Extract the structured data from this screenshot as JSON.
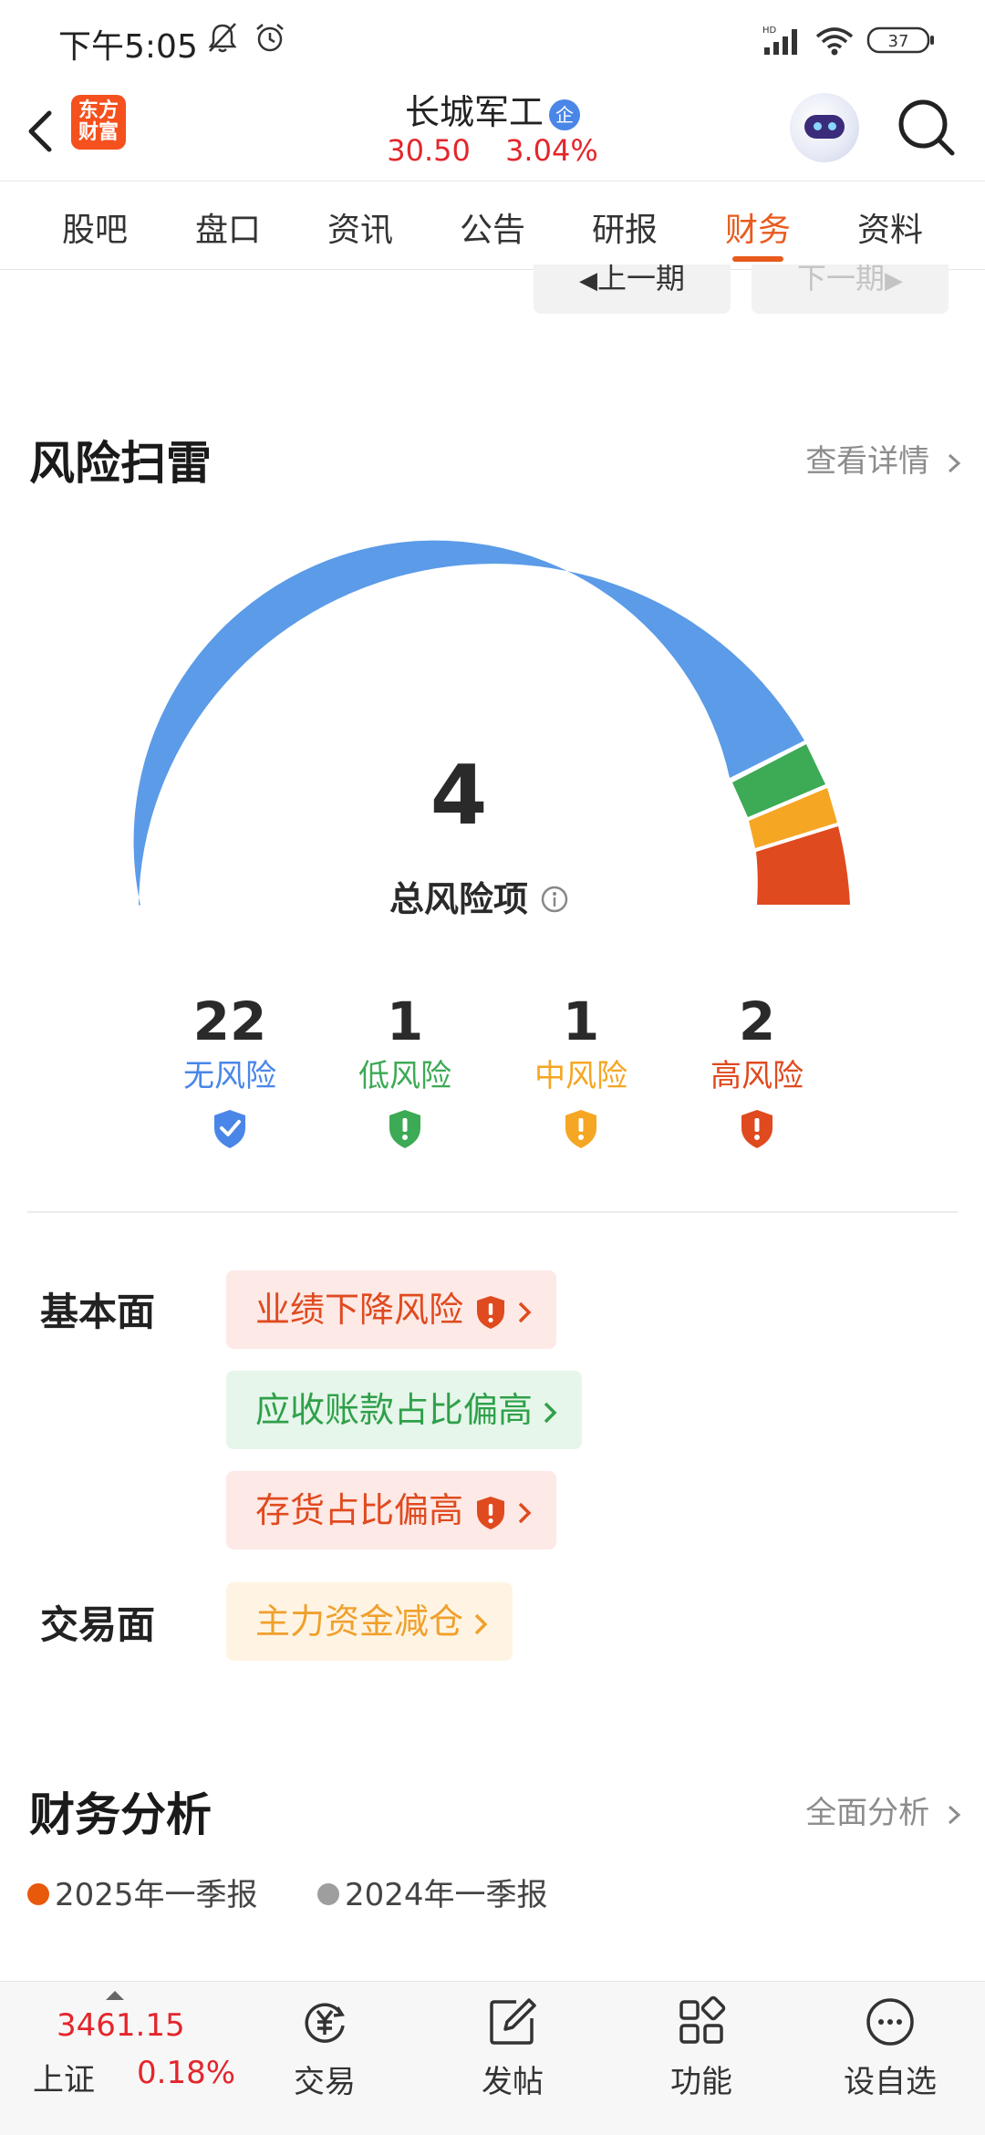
{
  "status_bar": {
    "time": "下午5:05",
    "battery": "37",
    "network": "HD"
  },
  "header": {
    "logo_line1": "东方",
    "logo_line2": "财富",
    "stock_name": "长城军工",
    "enterprise_badge": "企",
    "price": "30.50",
    "change_pct": "3.04%"
  },
  "tabs": [
    "股吧",
    "盘口",
    "资讯",
    "公告",
    "研报",
    "财务",
    "资料"
  ],
  "active_tab": "财务",
  "period": {
    "prev": "上一期",
    "next": "下一期"
  },
  "risk": {
    "title": "风险扫雷",
    "details_link": "查看详情",
    "total": "4",
    "total_label": "总风险项",
    "counts": [
      {
        "num": "22",
        "label": "无风险",
        "color": "#4a86e8"
      },
      {
        "num": "1",
        "label": "低风险",
        "color": "#3daa55"
      },
      {
        "num": "1",
        "label": "中风险",
        "color": "#f5a623"
      },
      {
        "num": "2",
        "label": "高风险",
        "color": "#e04a1f"
      }
    ],
    "gauge_colors": {
      "none": "#5b9be8",
      "low": "#3daa55",
      "mid": "#f5a623",
      "high": "#e04a1f"
    }
  },
  "fundamentals": {
    "label": "基本面",
    "items": [
      {
        "text": "业绩下降风险",
        "level": "high"
      },
      {
        "text": "应收账款占比偏高",
        "level": "low"
      },
      {
        "text": "存货占比偏高",
        "level": "high"
      }
    ]
  },
  "trading": {
    "label": "交易面",
    "items": [
      {
        "text": "主力资金减仓",
        "level": "mid"
      }
    ]
  },
  "analysis": {
    "title": "财务分析",
    "link": "全面分析",
    "legend": [
      {
        "label": "2025年一季报",
        "color": "#e8590c"
      },
      {
        "label": "2024年一季报",
        "color": "#9e9e9e"
      }
    ]
  },
  "bottom_nav": {
    "index_value": "3461.15",
    "index_name": "上证",
    "index_change": "0.18%",
    "items": [
      {
        "label": "交易",
        "icon": "trade-yen-icon"
      },
      {
        "label": "发帖",
        "icon": "edit-icon"
      },
      {
        "label": "功能",
        "icon": "apps-icon"
      },
      {
        "label": "设自选",
        "icon": "more-circle-icon"
      }
    ]
  }
}
